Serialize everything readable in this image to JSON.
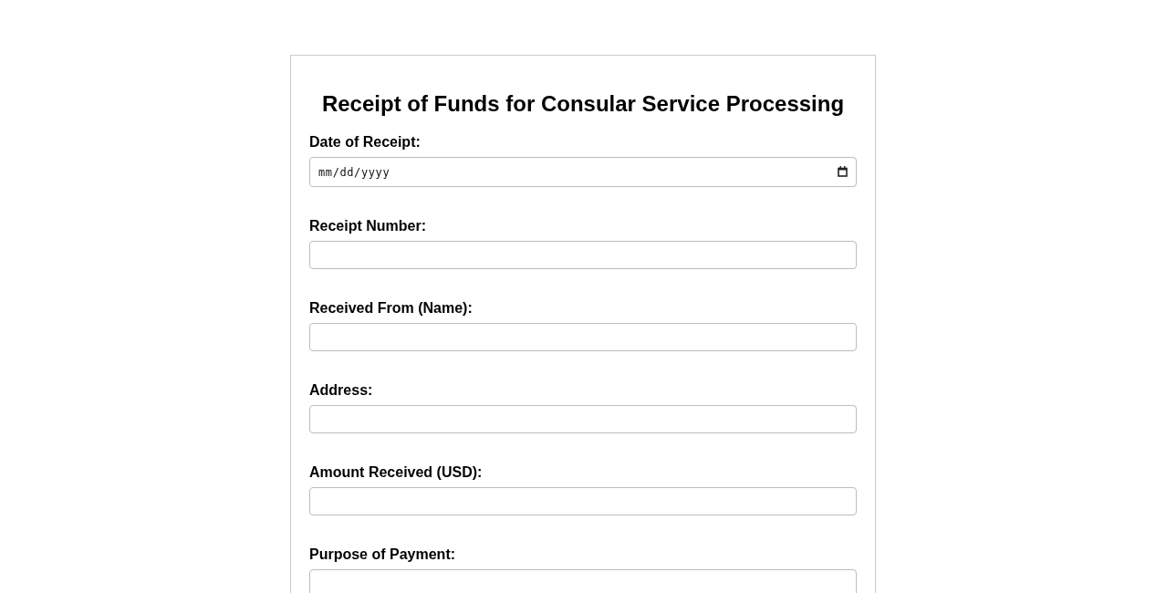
{
  "form": {
    "title": "Receipt of Funds for Consular Service Processing",
    "fields": [
      {
        "kind": "date",
        "label": "Date of Receipt:",
        "placeholder": "mm/dd/yyyy"
      },
      {
        "kind": "text",
        "label": "Receipt Number:"
      },
      {
        "kind": "text",
        "label": "Received From (Name):"
      },
      {
        "kind": "text",
        "label": "Address:"
      },
      {
        "kind": "text",
        "label": "Amount Received (USD):"
      },
      {
        "kind": "text",
        "label": "Purpose of Payment:"
      }
    ]
  }
}
